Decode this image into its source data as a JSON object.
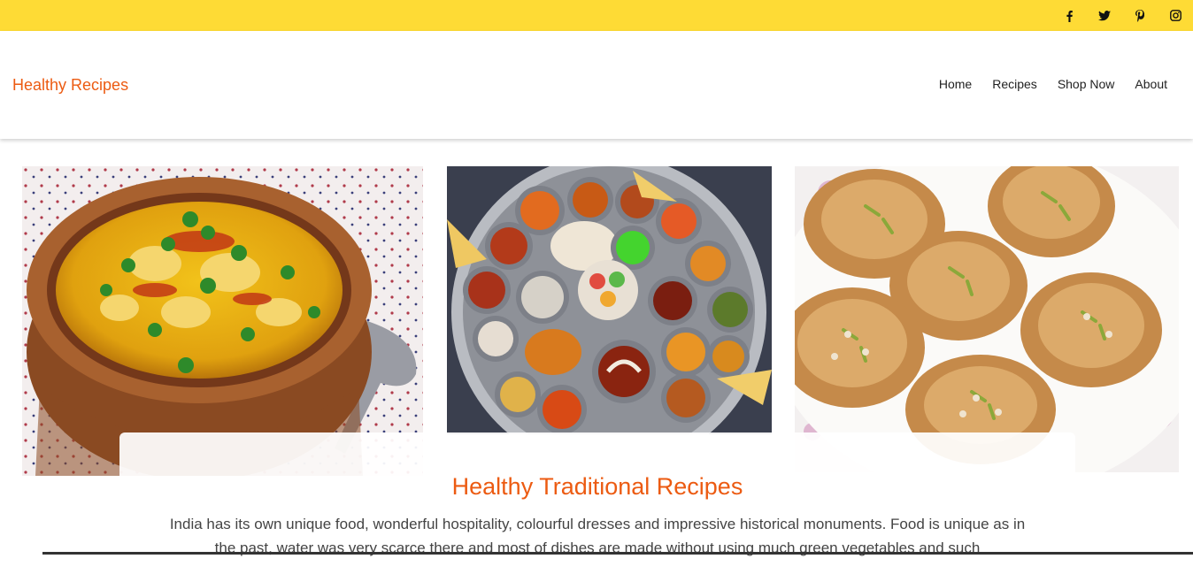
{
  "topbar": {
    "social": [
      {
        "icon": "facebook-icon",
        "glyph": "f"
      },
      {
        "icon": "twitter-icon",
        "glyph": "🐦"
      },
      {
        "icon": "pinterest-icon",
        "glyph": "P"
      },
      {
        "icon": "instagram-icon",
        "glyph": "◎"
      }
    ],
    "color": "#fedb35"
  },
  "header": {
    "brand": "Healthy Recipes",
    "nav": [
      "Home",
      "Recipes",
      "Shop Now",
      "About"
    ]
  },
  "hero": {
    "title": "Healthy Traditional Recipes",
    "text": "India has its own unique food, wonderful hospitality, colourful dresses and impressive historical monuments. Food is unique as in the past, water was very scarce there and most of dishes are made without using much green vegetables and such"
  },
  "colors": {
    "accent": "#ec5b12",
    "topbar": "#fedb35"
  }
}
